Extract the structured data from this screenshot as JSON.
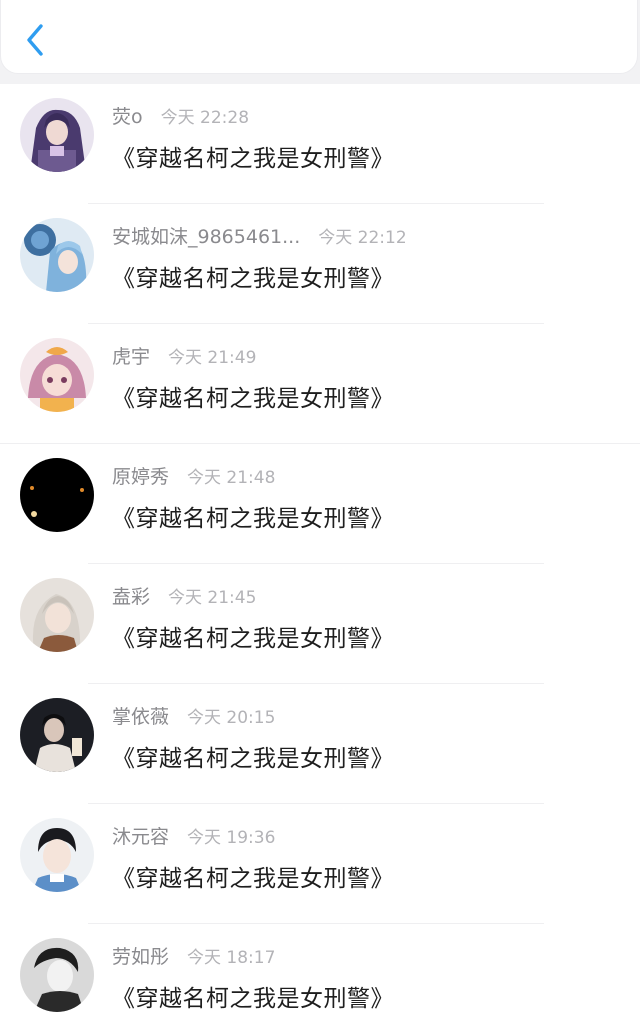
{
  "header": {
    "back_icon": "chevron-left-icon",
    "accent_color": "#2f9df0"
  },
  "comments": [
    {
      "username": "荧o",
      "time": "今天 22:28",
      "message": "《穿越名柯之我是女刑警》",
      "avatar": "anime-purple-hair-avatar"
    },
    {
      "username": "安城如沫_9865461...",
      "time": "今天 22:12",
      "message": "《穿越名柯之我是女刑警》",
      "avatar": "anime-blue-rose-avatar"
    },
    {
      "username": "虎宇",
      "time": "今天 21:49",
      "message": "《穿越名柯之我是女刑警》",
      "avatar": "anime-pink-hair-avatar"
    },
    {
      "username": "原婷秀",
      "time": "今天 21:48",
      "message": "《穿越名柯之我是女刑警》",
      "avatar": "black-lights-avatar"
    },
    {
      "username": "盍彩",
      "time": "今天 21:45",
      "message": "《穿越名柯之我是女刑警》",
      "avatar": "girl-photo-avatar"
    },
    {
      "username": "掌依薇",
      "time": "今天 20:15",
      "message": "《穿越名柯之我是女刑警》",
      "avatar": "dark-portrait-avatar"
    },
    {
      "username": "沐元容",
      "time": "今天 19:36",
      "message": "《穿越名柯之我是女刑警》",
      "avatar": "boy-photo-avatar"
    },
    {
      "username": "劳如彤",
      "time": "今天 18:17",
      "message": "《穿越名柯之我是女刑警》",
      "avatar": "bw-portrait-avatar"
    }
  ]
}
